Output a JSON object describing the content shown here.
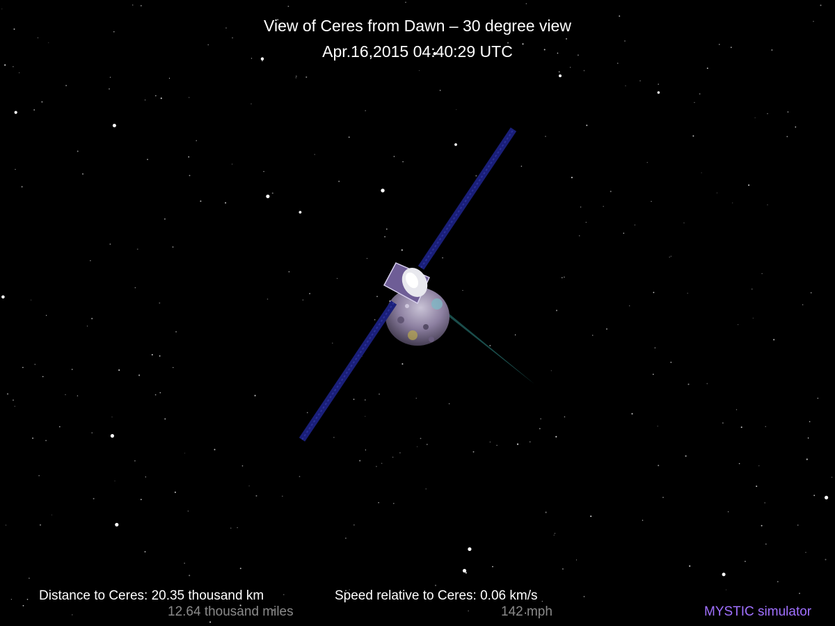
{
  "header": {
    "title": "View of Ceres from Dawn – 30 degree view",
    "timestamp": "Apr.16,2015 04:40:29  UTC"
  },
  "stats": {
    "distance_km": "Distance to Ceres: 20.35 thousand km",
    "distance_miles": "12.64 thousand miles",
    "speed_kms": "Speed relative to Ceres: 0.06 km/s",
    "speed_mph": "142 mph"
  },
  "credit": "MYSTIC simulator",
  "colors": {
    "background": "#000000",
    "text": "#ffffff",
    "secondary_text": "#8a8a8a",
    "credit": "#a070ff",
    "solar_panel": "#1a1f7a",
    "beam": "#1f5a58"
  }
}
